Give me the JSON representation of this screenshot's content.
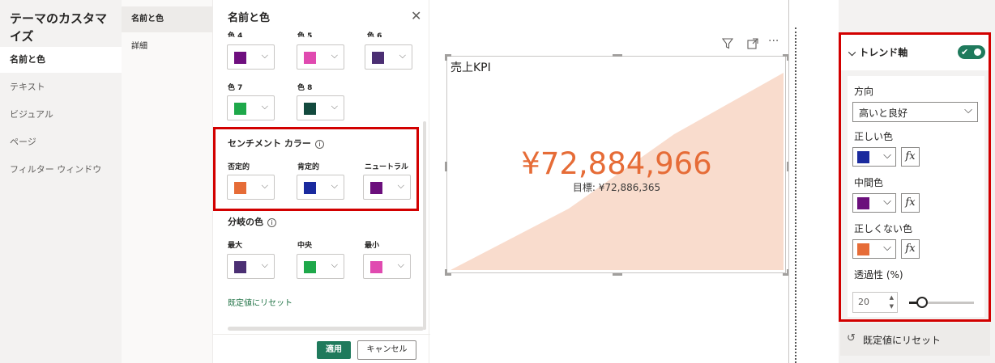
{
  "nav": {
    "title": "テーマのカスタマイズ",
    "items": [
      "名前と色",
      "テキスト",
      "ビジュアル",
      "ページ",
      "フィルター ウィンドウ"
    ]
  },
  "subnav": {
    "items": [
      "名前と色",
      "詳細"
    ]
  },
  "panel": {
    "title": "名前と色",
    "close_icon": "close-icon",
    "top_colors": [
      {
        "label": "色 4",
        "color": "#6f0f7f"
      },
      {
        "label": "色 5",
        "color": "#e04ab0"
      },
      {
        "label": "色 6",
        "color": "#4b2f73"
      }
    ],
    "colors_row2": [
      {
        "label": "色 7",
        "color": "#1ea84a"
      },
      {
        "label": "色 8",
        "color": "#134a3e"
      }
    ],
    "sentiment": {
      "heading": "センチメント カラー",
      "items": [
        {
          "label": "否定的",
          "color": "#e66c37"
        },
        {
          "label": "肯定的",
          "color": "#1a2a9e"
        },
        {
          "label": "ニュートラル",
          "color": "#6b0f7c"
        }
      ]
    },
    "divergent": {
      "heading": "分岐の色",
      "items": [
        {
          "label": "最大",
          "color": "#4b2f73"
        },
        {
          "label": "中央",
          "color": "#1ea84a"
        },
        {
          "label": "最小",
          "color": "#e04ab0"
        }
      ]
    },
    "reset_link": "既定値にリセット",
    "apply_label": "適用",
    "cancel_label": "キャンセル"
  },
  "visual": {
    "title": "売上KPI",
    "value": "¥72,884,966",
    "goal": "目標: ¥72,886,365",
    "area_color": "#f9dccd",
    "icons": [
      "filter-icon",
      "focus-mode-icon",
      "more-options-icon"
    ]
  },
  "format_pane": {
    "section_label": "トレンド軸",
    "toggle_on": true,
    "direction_label": "方向",
    "direction_value": "高いと良好",
    "good_color_label": "正しい色",
    "good_color": "#1a2a9e",
    "neutral_color_label": "中間色",
    "neutral_color": "#6b0f7c",
    "bad_color_label": "正しくない色",
    "bad_color": "#e66c37",
    "fx_label": "fx",
    "transparency_label": "透過性 (%)",
    "transparency_value": "20",
    "transparency_level": 0.2,
    "reset_label": "既定値にリセット"
  },
  "accent": {
    "highlight": "#d20000",
    "brand_green": "#1f7a5c"
  }
}
